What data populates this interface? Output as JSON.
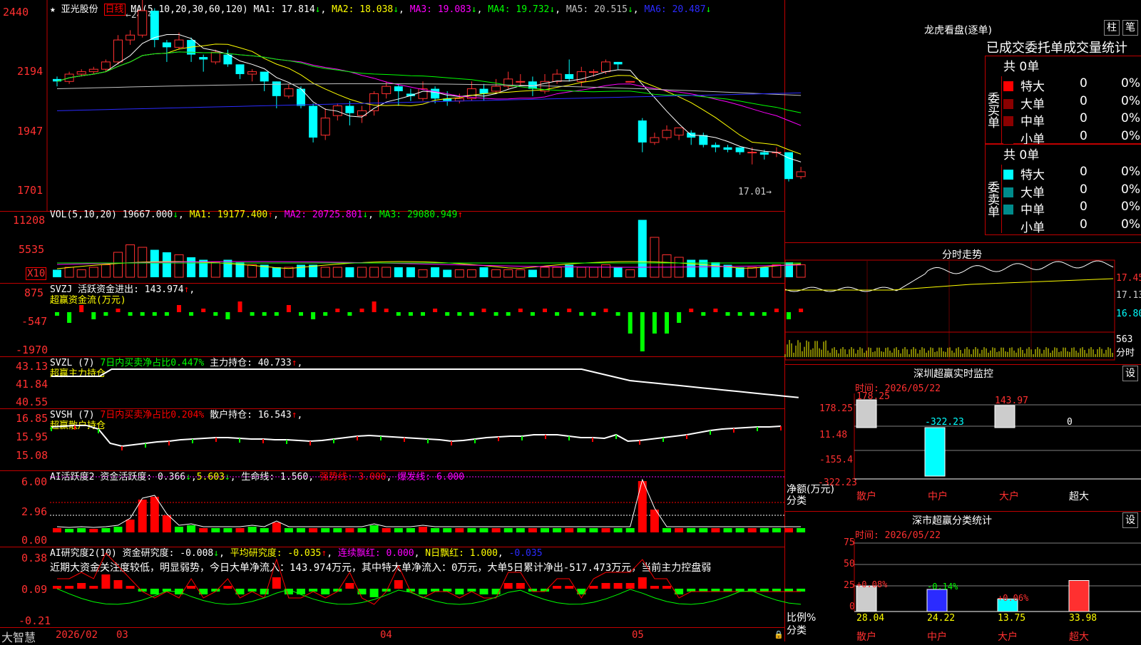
{
  "stock": {
    "name": "亚光股份",
    "period": "日线",
    "ma_params": "MA(5,10,20,30,60,120)",
    "ma1": "MA1: 17.814",
    "ma2": "MA2: 18.038",
    "ma3": "MA3: 19.083",
    "ma4": "MA4: 19.732",
    "ma5": "MA5: 20.515",
    "ma6": "MA6: 20.487",
    "high_mark": "24.40",
    "low_mark": "17.01",
    "price_axis": [
      "2440",
      "2194",
      "1947",
      "1701"
    ],
    "star": "★"
  },
  "vol": {
    "title": "VOL(5,10,20)",
    "val": "19667.000",
    "ma1": "MA1: 19177.400",
    "ma2": "MA2: 20725.801",
    "ma3": "MA3: 29080.949",
    "axis": [
      "11208",
      "5535",
      "X10"
    ]
  },
  "svzj": {
    "title": "SVZJ",
    "label": "活跃资金进出: 143.974",
    "sub": "超赢资金流(万元)",
    "axis": [
      "875",
      "-547",
      "-1970"
    ]
  },
  "svzl": {
    "title": "SVZL (7)",
    "text1": "7日内买卖净占比0.447%",
    "label": "主力持仓: 40.733",
    "sub": "超赢主力持仓",
    "axis": [
      "43.13",
      "41.84",
      "40.55"
    ]
  },
  "svsh": {
    "title": "SVSH (7)",
    "text1": "7日内买卖净占比0.204%",
    "label": "散户持仓: 16.543",
    "sub": "超赢散户持仓",
    "axis": [
      "16.85",
      "15.95",
      "15.08"
    ]
  },
  "ai1": {
    "title": "AI活跃度2",
    "l1": "资金活跃度: 0.366",
    "l2": "5.603",
    "l3": "生命线: 1.560",
    "l4": "强势线: 3.000",
    "l5": "爆发线: 6.000",
    "axis": [
      "6.00",
      "2.96",
      "0.00"
    ]
  },
  "ai2": {
    "title": "AI研究度2(10)",
    "l1": "资金研究度: -0.008",
    "l2": "平均研究度: -0.035",
    "l3": "连续飘红: 0.000",
    "l4": "N日飘红: 1.000",
    "l5": "-0.035",
    "comment": "近期大资金关注度较低，明显弱势，今日大单净流入：143.974万元，其中特大单净流入：0万元，大单5日累计净出-517.473万元，当前主力控盘弱",
    "axis": [
      "0.38",
      "0.09",
      "-0.21"
    ]
  },
  "bottom": {
    "brand": "大智慧",
    "date1": "2026/02",
    "m1": "03",
    "m2": "04",
    "m3": "05"
  },
  "lhb": {
    "title": "龙虎看盘(逐单)",
    "btn1": "柱",
    "btn2": "笔",
    "header": "已成交委托单成交量统计",
    "buy_label": "委买单",
    "sell_label": "委卖单",
    "buy_total": "共 0单",
    "sell_total": "共 0单",
    "rows": [
      "特大",
      "大单",
      "中单",
      "小单"
    ],
    "zero": "0",
    "pct": "0%",
    "buy_colors": [
      "#ff0000",
      "#8b0000",
      "#8b0000",
      "#000000"
    ],
    "sell_colors": [
      "#00ffff",
      "#008b8b",
      "#008b8b",
      "#000000"
    ]
  },
  "fenshi": {
    "title": "分时走势",
    "axis": [
      "17.45",
      "17.13",
      "16.80"
    ],
    "vol1": "563",
    "vol2": "分时"
  },
  "monitor": {
    "title": "深圳超赢实时监控",
    "btn": "设",
    "time": "时间: 2026/05/22",
    "axis": [
      "178.25",
      "11.48",
      "-155.4",
      "-322.23"
    ],
    "ylabel": "净额(万元)",
    "xlabel": "分类",
    "cats": [
      "散户",
      "中户",
      "大户",
      "超大"
    ],
    "vals": [
      "178.25",
      "-322.23",
      "143.97",
      "0"
    ]
  },
  "classify": {
    "title": "深市超赢分类统计",
    "btn": "设",
    "time": "时间: 2026/05/22",
    "axis": [
      "75",
      "50",
      "25",
      "0"
    ],
    "ylabel": "比例%",
    "xlabel": "分类",
    "cats": [
      "散户",
      "中户",
      "大户",
      "超大"
    ],
    "vals": [
      "28.04",
      "24.22",
      "13.75",
      "33.98"
    ],
    "changes": [
      "+0.08%",
      "-0.14%",
      "+0.06%",
      ""
    ]
  },
  "chart_data": {
    "type": "candlestick",
    "candles": [
      [
        21.6,
        21.5,
        21.7,
        21.3
      ],
      [
        21.5,
        21.8,
        21.9,
        21.4
      ],
      [
        21.8,
        21.9,
        22.0,
        21.7
      ],
      [
        21.9,
        22.0,
        22.1,
        21.8
      ],
      [
        22.0,
        22.3,
        22.4,
        21.9
      ],
      [
        22.3,
        23.2,
        23.4,
        22.2
      ],
      [
        23.2,
        23.4,
        23.6,
        23.0
      ],
      [
        23.4,
        24.4,
        25.4,
        23.3
      ],
      [
        24.4,
        23.2,
        24.5,
        22.9
      ],
      [
        23.1,
        22.9,
        23.2,
        22.3
      ],
      [
        22.9,
        23.2,
        23.5,
        22.8
      ],
      [
        23.2,
        22.6,
        23.3,
        22.3
      ],
      [
        22.5,
        22.4,
        22.6,
        21.9
      ],
      [
        22.3,
        22.7,
        22.8,
        22.2
      ],
      [
        22.6,
        22.2,
        22.8,
        22.1
      ],
      [
        22.2,
        21.8,
        22.2,
        21.6
      ],
      [
        21.8,
        21.9,
        22.0,
        21.5
      ],
      [
        21.9,
        21.5,
        21.9,
        21.1
      ],
      [
        21.5,
        20.9,
        21.5,
        20.4
      ],
      [
        20.9,
        21.2,
        21.4,
        20.8
      ],
      [
        21.2,
        20.5,
        21.3,
        20.4
      ],
      [
        20.5,
        19.2,
        20.6,
        19.0
      ],
      [
        19.3,
        20.0,
        20.4,
        19.1
      ],
      [
        20.1,
        20.5,
        20.6,
        19.9
      ],
      [
        20.5,
        20.2,
        20.7,
        19.7
      ],
      [
        20.1,
        20.3,
        20.5,
        19.8
      ],
      [
        20.3,
        21.0,
        21.1,
        20.1
      ],
      [
        21.0,
        21.3,
        21.5,
        20.8
      ],
      [
        21.3,
        21.1,
        21.4,
        20.5
      ],
      [
        21.0,
        20.9,
        21.2,
        20.7
      ],
      [
        20.8,
        21.2,
        21.5,
        20.7
      ],
      [
        21.2,
        20.8,
        21.3,
        20.6
      ],
      [
        20.8,
        20.7,
        21.1,
        20.5
      ],
      [
        20.7,
        20.8,
        21.0,
        20.6
      ],
      [
        20.8,
        21.2,
        21.5,
        20.7
      ],
      [
        21.2,
        21.0,
        21.4,
        20.7
      ],
      [
        21.1,
        21.3,
        21.6,
        21.0
      ],
      [
        21.3,
        21.6,
        21.9,
        21.2
      ],
      [
        21.5,
        21.5,
        21.8,
        21.3
      ],
      [
        21.5,
        21.2,
        21.7,
        20.9
      ],
      [
        21.1,
        21.5,
        21.8,
        21.0
      ],
      [
        21.5,
        21.8,
        22.0,
        21.4
      ],
      [
        21.8,
        21.6,
        22.4,
        21.5
      ],
      [
        21.5,
        21.9,
        22.1,
        21.3
      ],
      [
        21.9,
        21.9,
        22.0,
        21.7
      ],
      [
        21.9,
        22.3,
        22.4,
        21.8
      ],
      [
        22.3,
        22.2,
        22.3,
        22.0
      ],
      [
        21.5,
        21.5,
        21.5,
        21.5
      ],
      [
        19.9,
        19.0,
        20.0,
        18.6
      ],
      [
        19.0,
        19.2,
        19.4,
        18.9
      ],
      [
        19.2,
        19.5,
        19.7,
        19.1
      ],
      [
        19.3,
        19.6,
        19.6,
        19.1
      ],
      [
        19.4,
        19.2,
        19.5,
        18.9
      ],
      [
        19.3,
        18.9,
        19.4,
        18.8
      ],
      [
        18.9,
        18.8,
        19.0,
        18.6
      ],
      [
        18.8,
        18.7,
        18.9,
        18.6
      ],
      [
        18.8,
        18.6,
        18.8,
        18.5
      ],
      [
        18.6,
        18.6,
        18.8,
        18.1
      ],
      [
        18.6,
        18.5,
        18.7,
        18.3
      ],
      [
        18.6,
        18.6,
        18.8,
        18.4
      ],
      [
        18.6,
        17.5,
        18.6,
        17.4
      ],
      [
        17.6,
        17.8,
        18.0,
        17.5
      ]
    ],
    "y_range": [
      17.01,
      24.4
    ]
  }
}
